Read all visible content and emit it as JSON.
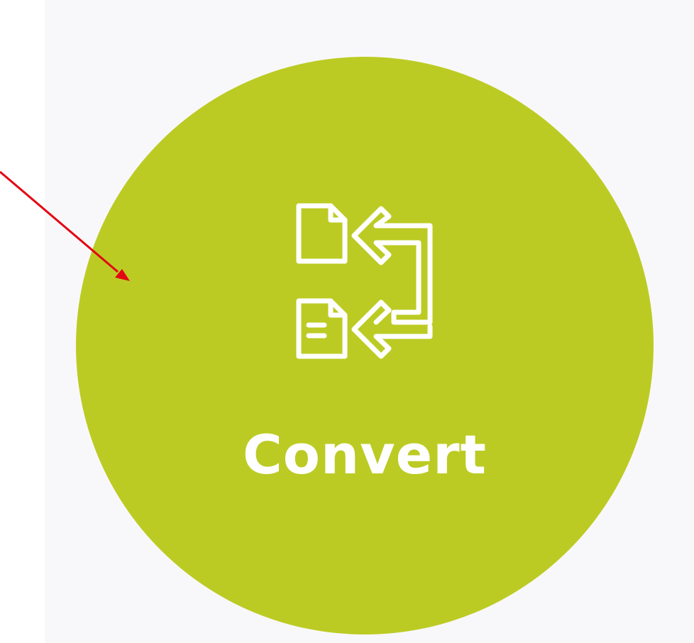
{
  "convert_tile": {
    "label": "Convert",
    "icon": "file-convert-icon",
    "circle_color": "#bccb23",
    "foreground_color": "#ffffff"
  },
  "annotation": {
    "icon": "red-arrow-annotation",
    "color": "#e30613"
  },
  "panel": {
    "background_color": "#f8f8fa"
  }
}
